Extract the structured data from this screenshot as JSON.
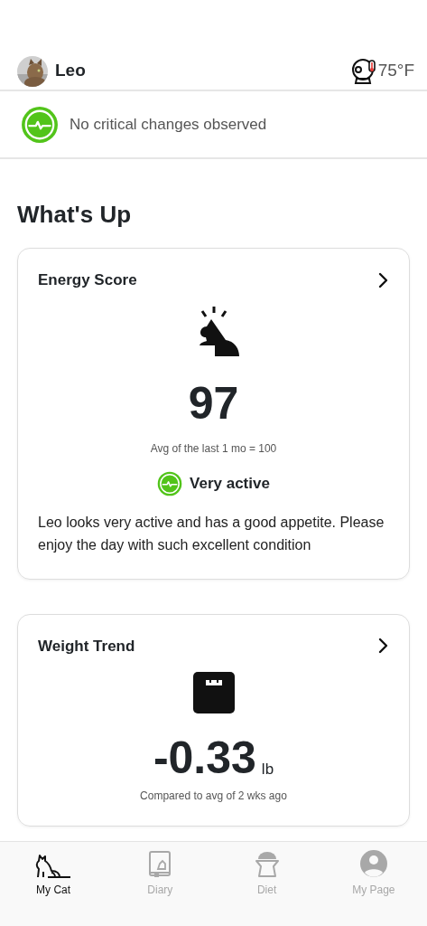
{
  "header": {
    "pet_name": "Leo",
    "temperature": "75°F"
  },
  "status": {
    "text": "No critical changes observed"
  },
  "section_title": "What's Up",
  "cards": [
    {
      "kind": "energy",
      "title": "Energy Score",
      "value": "97",
      "caption": "Avg of the last 1 mo = 100",
      "rating": "Very active",
      "description": "Leo looks very active and has a good appetite. Please enjoy the day with such excellent condition"
    },
    {
      "kind": "weight",
      "title": "Weight Trend",
      "value": "-0.33",
      "unit": "lb",
      "caption": "Compared to avg of 2 wks ago"
    }
  ],
  "tabs": [
    {
      "kind": "cat",
      "label": "My Cat",
      "selected": true
    },
    {
      "kind": "diary",
      "label": "Diary",
      "selected": false
    },
    {
      "kind": "diet",
      "label": "Diet",
      "selected": false
    },
    {
      "kind": "page",
      "label": "My Page",
      "selected": false
    }
  ]
}
